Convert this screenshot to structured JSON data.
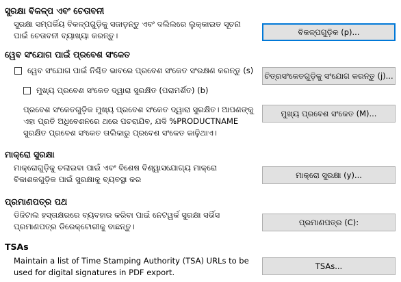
{
  "security_warnings": {
    "heading": "ସୁରକ୍ଷା ବିକଳ୍ପ ଏବଂ ଚେତାବନୀ",
    "description": "ସୁରକ୍ଷା ସମ୍ପର୍କିୟ ବିକଳ୍ପଗୁଡ଼ିକୁ ସଜାଡ଼ନ୍ତୁ ଏବଂ ଦଲିଲରେ ଲୁକ୍କାଇତ ସୂଚନା ପାଇଁ ଚେତାବନୀ ବ୍ୟାଖ୍ୟା କରନ୍ତୁ।",
    "button": "ବିକଳ୍ପଗୁଡ଼ିକ (p)..."
  },
  "web_passwords": {
    "heading": "ୱେବ ସଂଯୋଗ ପାଇଁ ପ୍ରବେଶ ସଂକେତ",
    "persist_checkbox": "ୱେବ ସଂଯୋଗ ପାଇଁ ନିଶ୍ଚିତ ଭାବରେ ପ୍ରବେଶ ସଂକେତ ସଂରକ୍ଷଣ କରନ୍ତୁ (s)",
    "persist_checked": false,
    "master_checkbox": "ମୁଖ୍ୟ ପ୍ରବେଶ ସଂକେତ ଦ୍ୱାରା ସୁରକ୍ଷିତ (ପରାମର୍ଶିତ) (b)",
    "master_checked": false,
    "connections_button": "ଚିତ୍ରସଂକେତଗୁଡ଼ିକୁ ସଂଯୋଗ କରନ୍ତୁ (j)...",
    "master_description": "ପ୍ରବେଶ ସଂକେତଗୁଡ଼ିକ ମୁଖ୍ୟ ପ୍ରବେଶ ସଂକେତ ଦ୍ୱାରା ସୁରକ୍ଷିତ। ଆପଣଙ୍କୁ ଏହା ପ୍ରତି ଅଧିବେଶନରେ ଥରେ ପଚରାଯିବ, ଯଦି %PRODUCTNAME ସୁରକ୍ଷିତ ପ୍ରବେଶ ସଂକେତ ତାଲିକାରୁ ପ୍ରବେଶ ସଂକେତ କାଢ଼ିଥାଏ।",
    "master_button": "ମୁଖ୍ୟ ପ୍ରବେଶ ସଂକେତ (M)..."
  },
  "macro_security": {
    "heading": "ମାକ୍ରୋ ସୁରକ୍ଷା",
    "description": "ମାକ୍ରୋଗୁଡ଼ିକୁ ଚଲାଇବା ପାଇଁ ଏବଂ ବିଶେଷ ବିଶ୍ୱାସଯୋଗ୍ୟ ମାକ୍ରୋ ବିକାଶକଗୁଡ଼ିକ ପାଇଁ ସୁରକ୍ଷାକୁ ବ୍ୟବସ୍ଥା କର",
    "button": "ମାକ୍ରୋ ସୁରକ୍ଷା (y)..."
  },
  "certificate_path": {
    "heading": "ପ୍ରମାଣପତ୍ର ପଥ",
    "description": "ଡିଜିଟାଲ ହସ୍ତାକ୍ଷରରେ ବ୍ୟବହାର କରିବା ପାଇଁ ନେଟୱର୍କ ସୁରକ୍ଷା ସର୍ଭିସ ପ୍ରମାଣପତ୍ର ଡିରେକ୍ଟୋରୀକୁ ବାଛନ୍ତୁ।",
    "button": "ପ୍ରମାଣପତ୍ର (C):"
  },
  "tsas": {
    "heading": "TSAs",
    "description": "Maintain a list of Time Stamping Authority (TSA) URLs to be used for digital signatures in PDF export.",
    "button": "TSAs..."
  }
}
